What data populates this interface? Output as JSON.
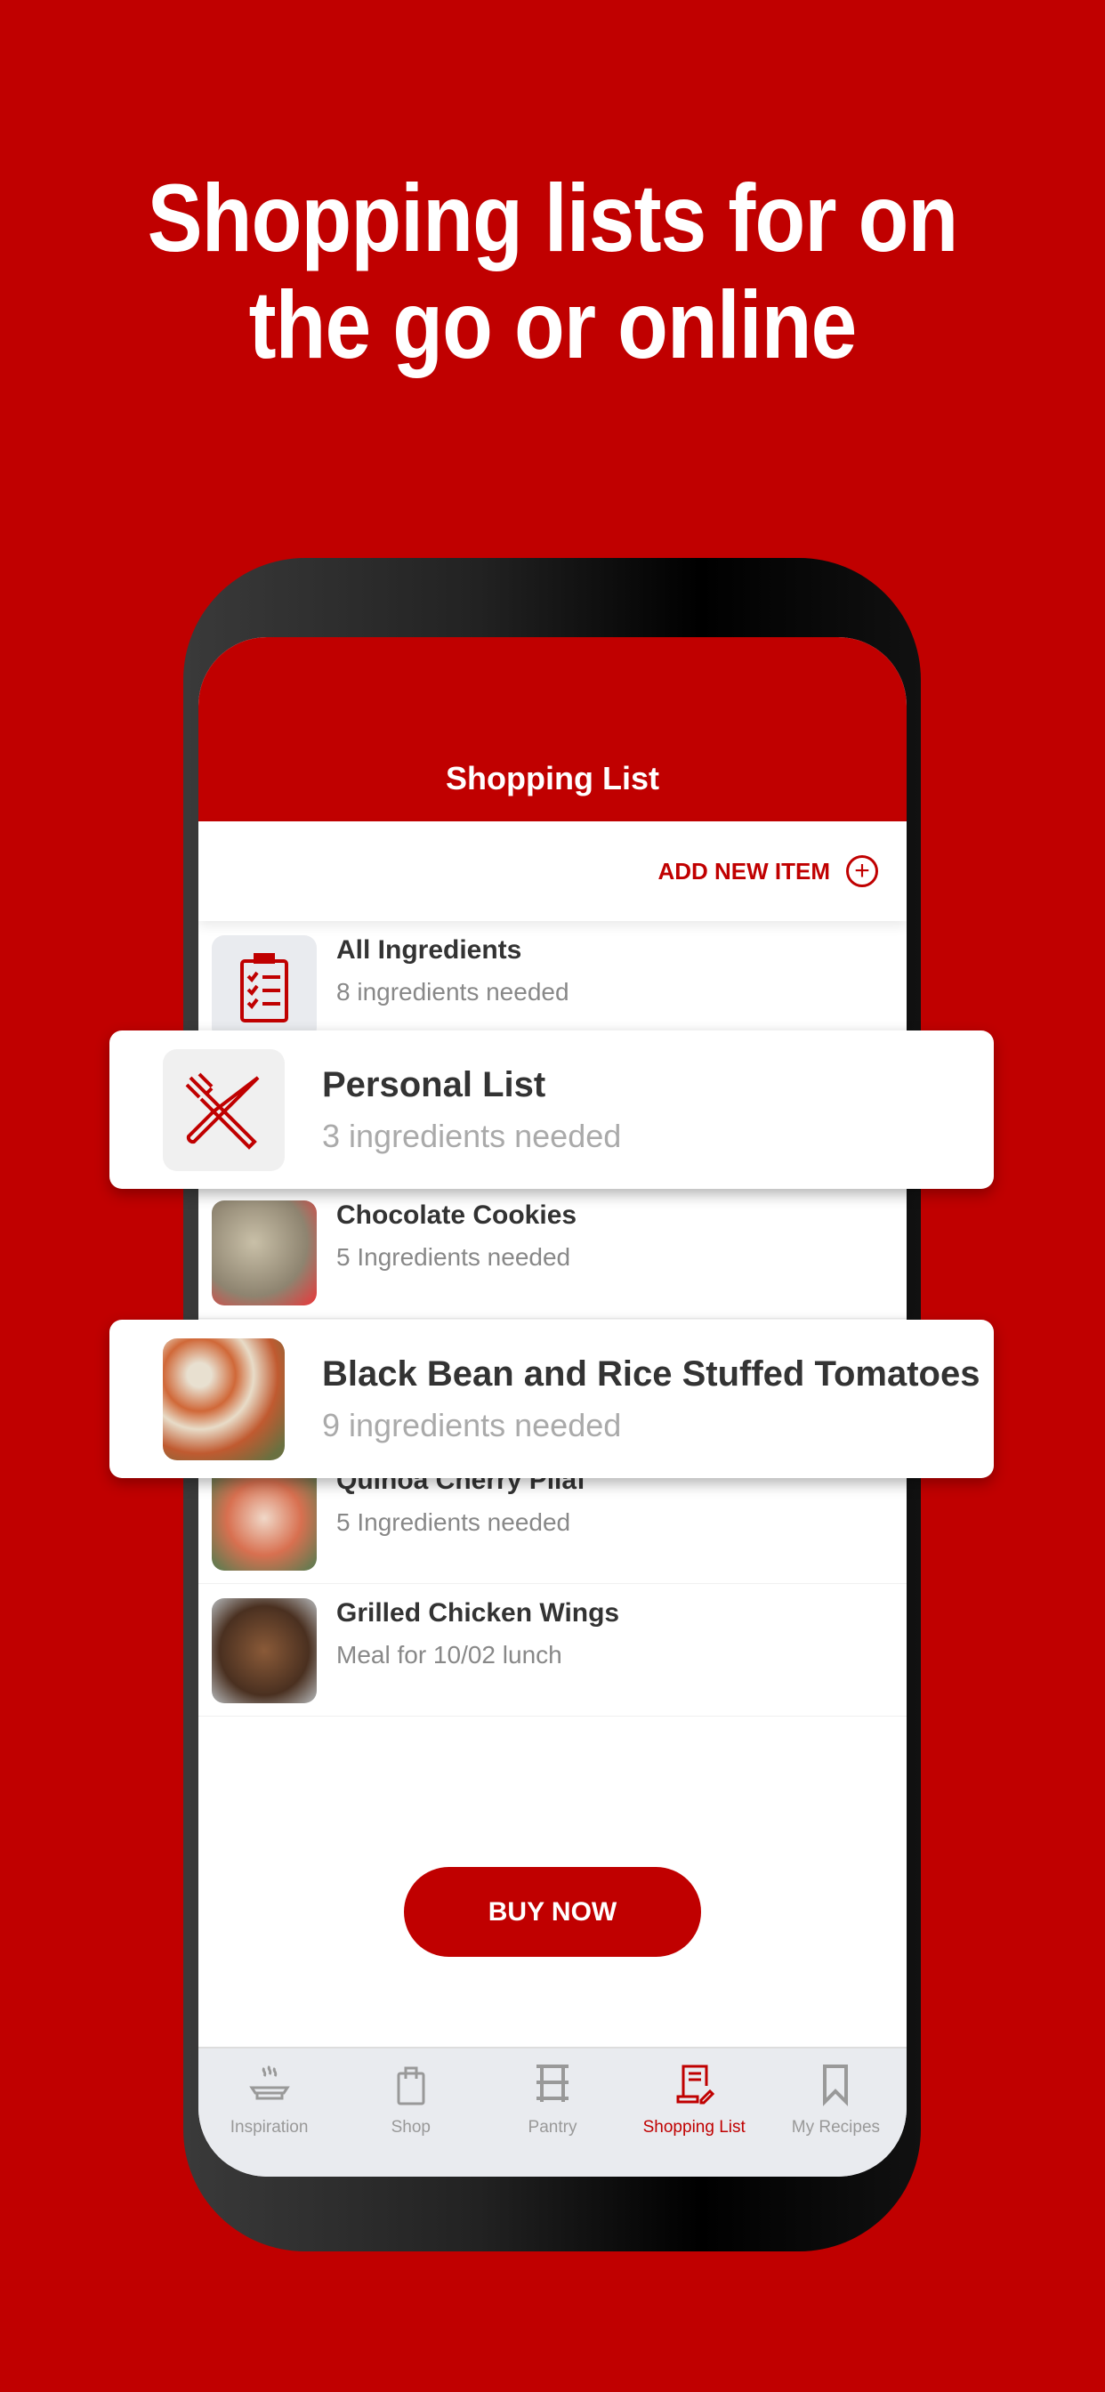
{
  "headline": [
    "Shopping lists for on",
    "the go or online"
  ],
  "header": {
    "title": "Shopping List"
  },
  "add_new_item": "ADD NEW ITEM",
  "lists": [
    {
      "title": "All Ingredients",
      "subtitle": "8 ingredients needed",
      "icon": "clipboard-checklist-icon"
    },
    {
      "title": "Personal List",
      "subtitle": "3 ingredients needed",
      "icon": "fork-knife-icon"
    },
    {
      "title": "Chocolate Cookies",
      "subtitle": "5 Ingredients needed"
    },
    {
      "title": "Black Bean and Rice Stuffed Tomatoes",
      "subtitle": "9 ingredients needed"
    },
    {
      "title": "Quinoa Cherry Pilaf",
      "subtitle": "5 Ingredients needed"
    },
    {
      "title": "Grilled Chicken Wings",
      "subtitle": "Meal for 10/02 lunch"
    }
  ],
  "buy_now": "BUY NOW",
  "tabs": [
    {
      "label": "Inspiration",
      "icon": "steaming-bowl-icon"
    },
    {
      "label": "Shop",
      "icon": "shopping-bag-icon"
    },
    {
      "label": "Pantry",
      "icon": "shelf-icon"
    },
    {
      "label": "Shopping List",
      "icon": "list-pencil-icon",
      "active": true
    },
    {
      "label": "My Recipes",
      "icon": "bookmark-icon"
    }
  ],
  "colors": {
    "brand": "#c00000",
    "tab_inactive": "#999999",
    "tabbar_bg": "#e9ebef"
  }
}
